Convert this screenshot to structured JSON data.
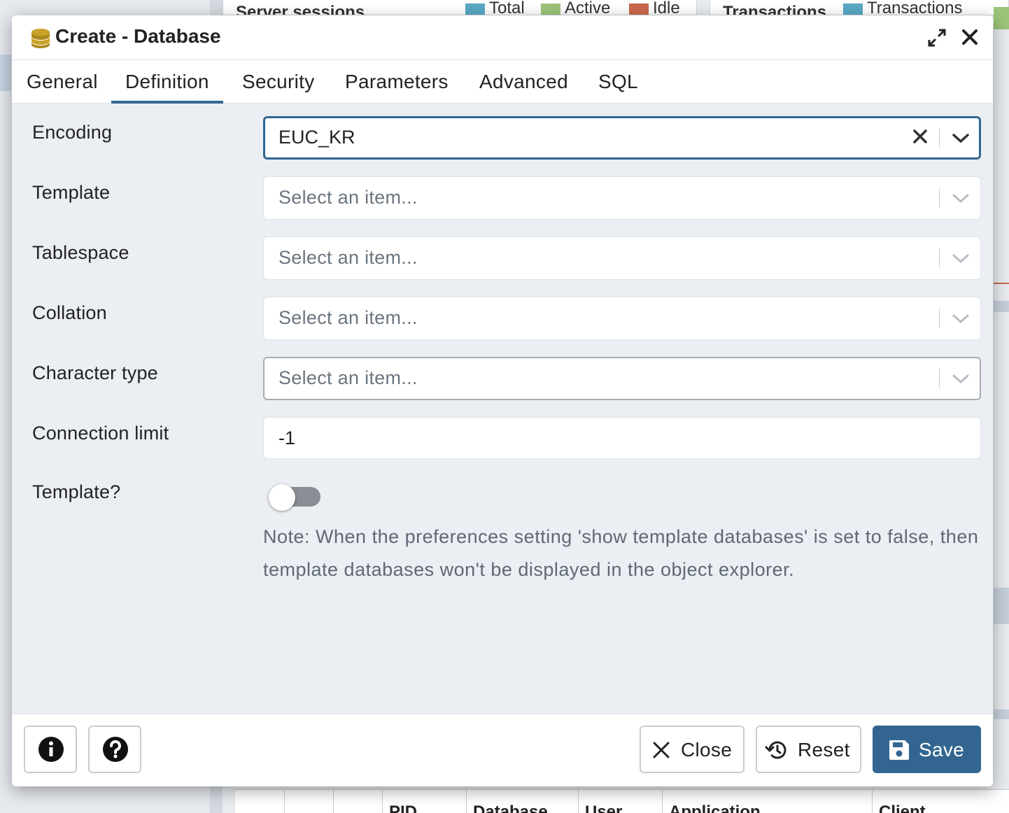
{
  "background": {
    "panels": [
      {
        "title": "Server sessions",
        "legend": [
          "Total",
          "Active",
          "Idle"
        ]
      },
      {
        "title": "Transactions",
        "legend": [
          "Transactions"
        ]
      }
    ],
    "table_headers": [
      "PID",
      "Database",
      "User",
      "Application",
      "Client"
    ]
  },
  "dialog": {
    "title": "Create - Database",
    "tabs": [
      {
        "label": "General"
      },
      {
        "label": "Definition"
      },
      {
        "label": "Security"
      },
      {
        "label": "Parameters"
      },
      {
        "label": "Advanced"
      },
      {
        "label": "SQL"
      }
    ],
    "active_tab": "Definition",
    "fields": {
      "encoding": {
        "label": "Encoding",
        "value": "EUC_KR"
      },
      "template": {
        "label": "Template",
        "placeholder": "Select an item..."
      },
      "tablespace": {
        "label": "Tablespace",
        "placeholder": "Select an item..."
      },
      "collation": {
        "label": "Collation",
        "placeholder": "Select an item..."
      },
      "character_type": {
        "label": "Character type",
        "placeholder": "Select an item..."
      },
      "connection_limit": {
        "label": "Connection limit",
        "value": "-1"
      },
      "is_template": {
        "label": "Template?",
        "value": false
      }
    },
    "note": "Note: When the preferences setting 'show template databases' is set to false, then template databases won't be displayed in the object explorer.",
    "footer": {
      "close_label": "Close",
      "reset_label": "Reset",
      "save_label": "Save"
    }
  },
  "colors": {
    "accent": "#326690",
    "legend_total": "#5aa9c4",
    "legend_active": "#9cc47a",
    "legend_idle": "#c96a4e"
  }
}
